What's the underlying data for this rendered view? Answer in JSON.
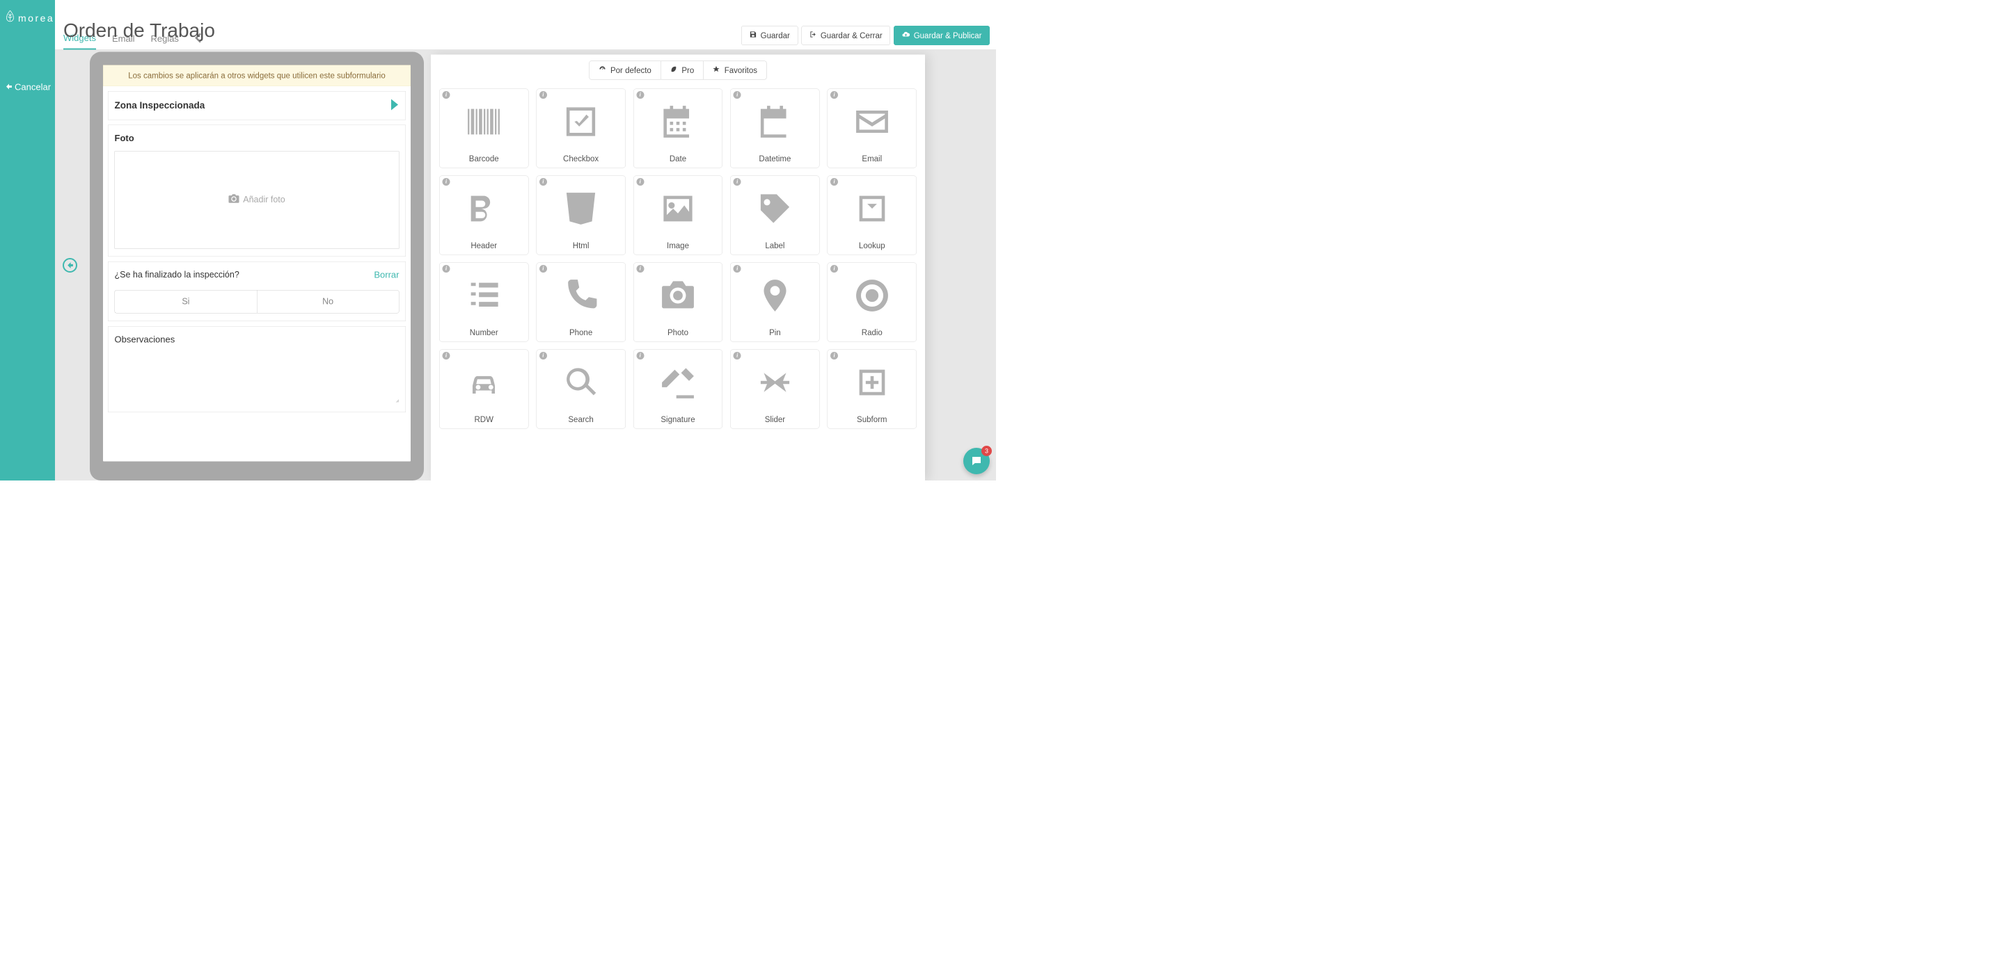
{
  "brand": "moreapp",
  "cancel": "Cancelar",
  "title": "Orden de Trabajo",
  "tabs": {
    "widgets": "Widgets",
    "email": "Email",
    "rules": "Reglas"
  },
  "actions": {
    "save": "Guardar",
    "saveClose": "Guardar & Cerrar",
    "savePublish": "Guardar & Publicar"
  },
  "notice": "Los cambios se aplicarán a otros widgets que utilicen este subformulario",
  "form": {
    "zoneTitle": "Zona Inspeccionada",
    "photoLabel": "Foto",
    "addPhoto": "Añadir foto",
    "radioQuestion": "¿Se ha finalizado la inspección?",
    "clear": "Borrar",
    "optYes": "Si",
    "optNo": "No",
    "observations": "Observaciones"
  },
  "pills": {
    "default": "Por defecto",
    "pro": "Pro",
    "favorites": "Favoritos"
  },
  "widgets": [
    {
      "key": "barcode",
      "label": "Barcode"
    },
    {
      "key": "checkbox",
      "label": "Checkbox"
    },
    {
      "key": "date",
      "label": "Date"
    },
    {
      "key": "datetime",
      "label": "Datetime"
    },
    {
      "key": "email",
      "label": "Email"
    },
    {
      "key": "header",
      "label": "Header"
    },
    {
      "key": "html",
      "label": "Html"
    },
    {
      "key": "image",
      "label": "Image"
    },
    {
      "key": "label",
      "label": "Label"
    },
    {
      "key": "lookup",
      "label": "Lookup"
    },
    {
      "key": "number",
      "label": "Number"
    },
    {
      "key": "phone",
      "label": "Phone"
    },
    {
      "key": "photo",
      "label": "Photo"
    },
    {
      "key": "pin",
      "label": "Pin"
    },
    {
      "key": "radio",
      "label": "Radio"
    },
    {
      "key": "rdw",
      "label": "RDW"
    },
    {
      "key": "search",
      "label": "Search"
    },
    {
      "key": "signature",
      "label": "Signature"
    },
    {
      "key": "slider",
      "label": "Slider"
    },
    {
      "key": "subform",
      "label": "Subform"
    }
  ],
  "chatBadge": "3"
}
